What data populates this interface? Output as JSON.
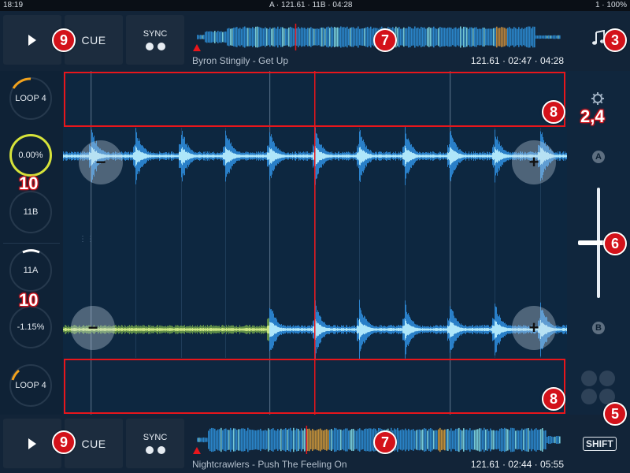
{
  "status_bar": {
    "time": "18:19",
    "center": "A · 121.61 · 11B · 04:28",
    "right": "1 · 100%"
  },
  "deck_a": {
    "cue_label": "CUE",
    "sync_label": "SYNC",
    "track": "Byron Stingily - Get Up",
    "meta": "121.61 · 02:47 · 04:28",
    "loop_label": "LOOP 4",
    "tempo": "0.00%",
    "key": "11B",
    "play_progress": 0.27
  },
  "deck_b": {
    "cue_label": "CUE",
    "sync_label": "SYNC",
    "track": "Nightcrawlers - Push The Feeling On",
    "meta": "121.61 · 02:44 · 05:55",
    "loop_label": "LOOP 4",
    "tempo": "-1.15%",
    "key": "11A",
    "play_progress": 0.3
  },
  "right_panel": {
    "deck_a_letter": "A",
    "deck_b_letter": "B",
    "shift_label": "SHIFT",
    "minus": "−",
    "plus": "+"
  },
  "callouts": {
    "c9": "9",
    "c7": "7",
    "c3": "3",
    "c8": "8",
    "c24": "2,4",
    "c10": "10",
    "c6": "6",
    "c5": "5"
  },
  "icons": {
    "music": "music-note-icon",
    "settings": "gear-icon",
    "play": "play-icon",
    "grid": "performance-pads-icon"
  },
  "colors": {
    "waveform_blue": "#2f8fe0",
    "waveform_cyan": "#bdf2ff",
    "waveform_yellow": "#d8f088",
    "playhead": "#e8161b",
    "tempo_ring": "#d6e33a",
    "loop_ring": "#f2a21c"
  }
}
